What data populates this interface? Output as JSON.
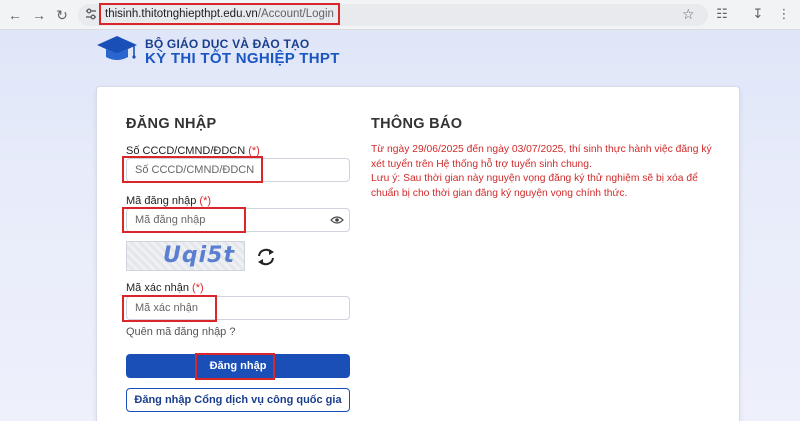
{
  "browser": {
    "url_host": "thisinh.thitotnghiepthpt.edu.vn",
    "url_path": "/Account/Login"
  },
  "header": {
    "ministry": "BỘ GIÁO DỤC VÀ ĐÀO TẠO",
    "exam_title": "KỲ THI TỐT NGHIỆP THPT"
  },
  "login": {
    "title": "ĐĂNG NHẬP",
    "id_label": "Số CCCD/CMND/ĐDCN",
    "id_placeholder": "Số CCCD/CMND/ĐDCN",
    "code_label": "Mã đăng nhập",
    "code_placeholder": "Mã đăng nhập",
    "captcha_text": "Uqi5t",
    "verify_label": "Mã xác nhận",
    "verify_placeholder": "Mã xác nhận",
    "required_mark": "(*)",
    "forgot_link": "Quên mã đăng nhập ?",
    "submit_label": "Đăng nhập",
    "portal_label": "Đăng nhập Cổng dịch vụ công quốc gia"
  },
  "notice": {
    "title": "THÔNG BÁO",
    "line1": "Từ ngày 29/06/2025 đến ngày 03/07/2025, thí sinh thực hành việc đăng ký xét tuyển trên Hệ thống hỗ trợ tuyển sinh chung.",
    "line2": "Lưu ý: Sau thời gian này nguyện vọng đăng ký thử nghiệm sẽ bị xóa để chuẩn bị cho thời gian đăng ký nguyện vọng chính thức."
  },
  "colors": {
    "primary": "#1a4fb8",
    "notice_red": "#d12a2a",
    "highlight_red": "#d9262b"
  }
}
